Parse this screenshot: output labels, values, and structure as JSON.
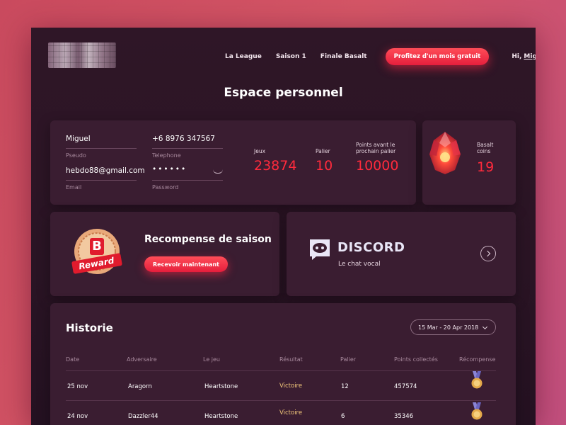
{
  "nav": {
    "links": [
      "La League",
      "Saison 1",
      "Finale Basalt"
    ],
    "cta": "Profitez d'un mois gratuit",
    "user_greeting": "Hi,",
    "user_name": "Miguell"
  },
  "page_title": "Espace personnel",
  "profile": {
    "pseudo_value": "Miguel",
    "pseudo_label": "Pseudo",
    "phone_value": "+6 8976 347567",
    "phone_label": "Telephone",
    "email_value": "hebdo88@gmail.com",
    "email_label": "Email",
    "password_value": "••••••",
    "password_label": "Password"
  },
  "stats": [
    {
      "label": "Jeux",
      "value": "23874"
    },
    {
      "label": "Palier",
      "value": "10"
    },
    {
      "label": "Points avant le prochain palier",
      "value": "10000"
    }
  ],
  "coins": {
    "label": "Basalt coins",
    "value": "19"
  },
  "reward": {
    "badge_letter": "B",
    "badge_text": "Reward",
    "title": "Recompense de saison",
    "button": "Recevoir maintenant"
  },
  "discord": {
    "name": "DISCORD",
    "subtitle": "Le chat vocal"
  },
  "history": {
    "title": "Historie",
    "date_range": "15 Mar - 20 Apr 2018",
    "columns": [
      "Date",
      "Adversaire",
      "Le jeu",
      "Résultat",
      "Palier",
      "Points collectés",
      "Récompense"
    ],
    "rows": [
      [
        "25 nov",
        "Aragorn",
        "Heartstone",
        "Victoire",
        "12",
        "457574"
      ],
      [
        "24 nov",
        "Dazzler44",
        "Heartstone",
        "Victoire",
        "6",
        "35346"
      ]
    ]
  },
  "colors": {
    "accent": "#ff2a3c",
    "background": "#2a1424",
    "card": "#3a1d31"
  }
}
